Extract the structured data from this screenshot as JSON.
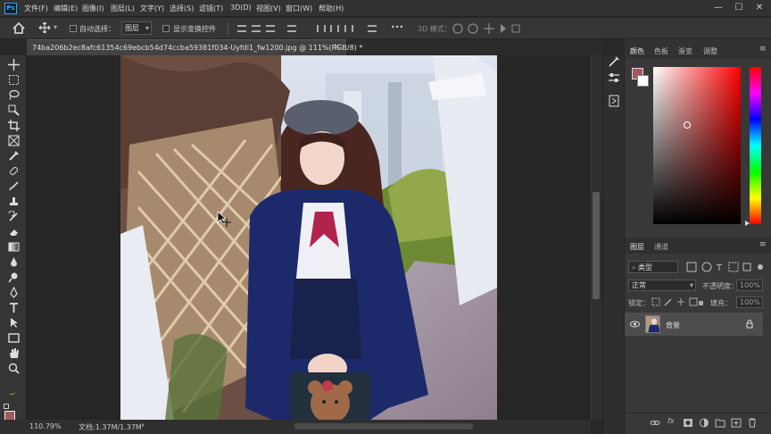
{
  "app": {
    "logo": "Ps"
  },
  "menu": [
    "文件(F)",
    "编辑(E)",
    "图像(I)",
    "图层(L)",
    "文字(Y)",
    "选择(S)",
    "滤镜(T)",
    "3D(D)",
    "视图(V)",
    "窗口(W)",
    "帮助(H)"
  ],
  "window_controls": {
    "minimize": "—",
    "maximize": "☐",
    "close": "✕"
  },
  "options_bar": {
    "auto_select_label": "自动选择：",
    "auto_select_value": "图层",
    "show_transform_label": "显示变换控件",
    "more_label": "•••",
    "mode_3d_label": "3D 模式："
  },
  "document_tab": {
    "title": "74ba206b2ec8afc61354c69ebcb54d74ccba59381f034-Uyfdi1_fw1200.jpg @ 111%(RGB/8) *",
    "close": "×"
  },
  "status_bar": {
    "zoom": "110.79%",
    "doc_info": "文档:1.37M/1.37M",
    "arrow": "›"
  },
  "color_panel": {
    "tabs": [
      "颜色",
      "色板",
      "渐变",
      "调整"
    ],
    "foreground": "#a15a5d",
    "background": "#ffffff"
  },
  "layers_panel": {
    "tabs": [
      "图层",
      "通道"
    ],
    "kind_filter": "类型",
    "blend_mode": "正常",
    "opacity_label": "不透明度：",
    "opacity_value": "100%",
    "lock_label": "锁定：",
    "fill_label": "填充：",
    "fill_value": "100%",
    "layers": [
      {
        "name": "背景",
        "visible": true,
        "locked": true
      }
    ],
    "bottom_icons": [
      "link-icon",
      "fx-icon",
      "mask-icon",
      "adjustment-icon",
      "group-icon",
      "new-layer-icon",
      "delete-icon"
    ]
  },
  "colors": {
    "accent": "#31a8ff",
    "panel": "#323232",
    "canvas_bg": "#262626"
  }
}
